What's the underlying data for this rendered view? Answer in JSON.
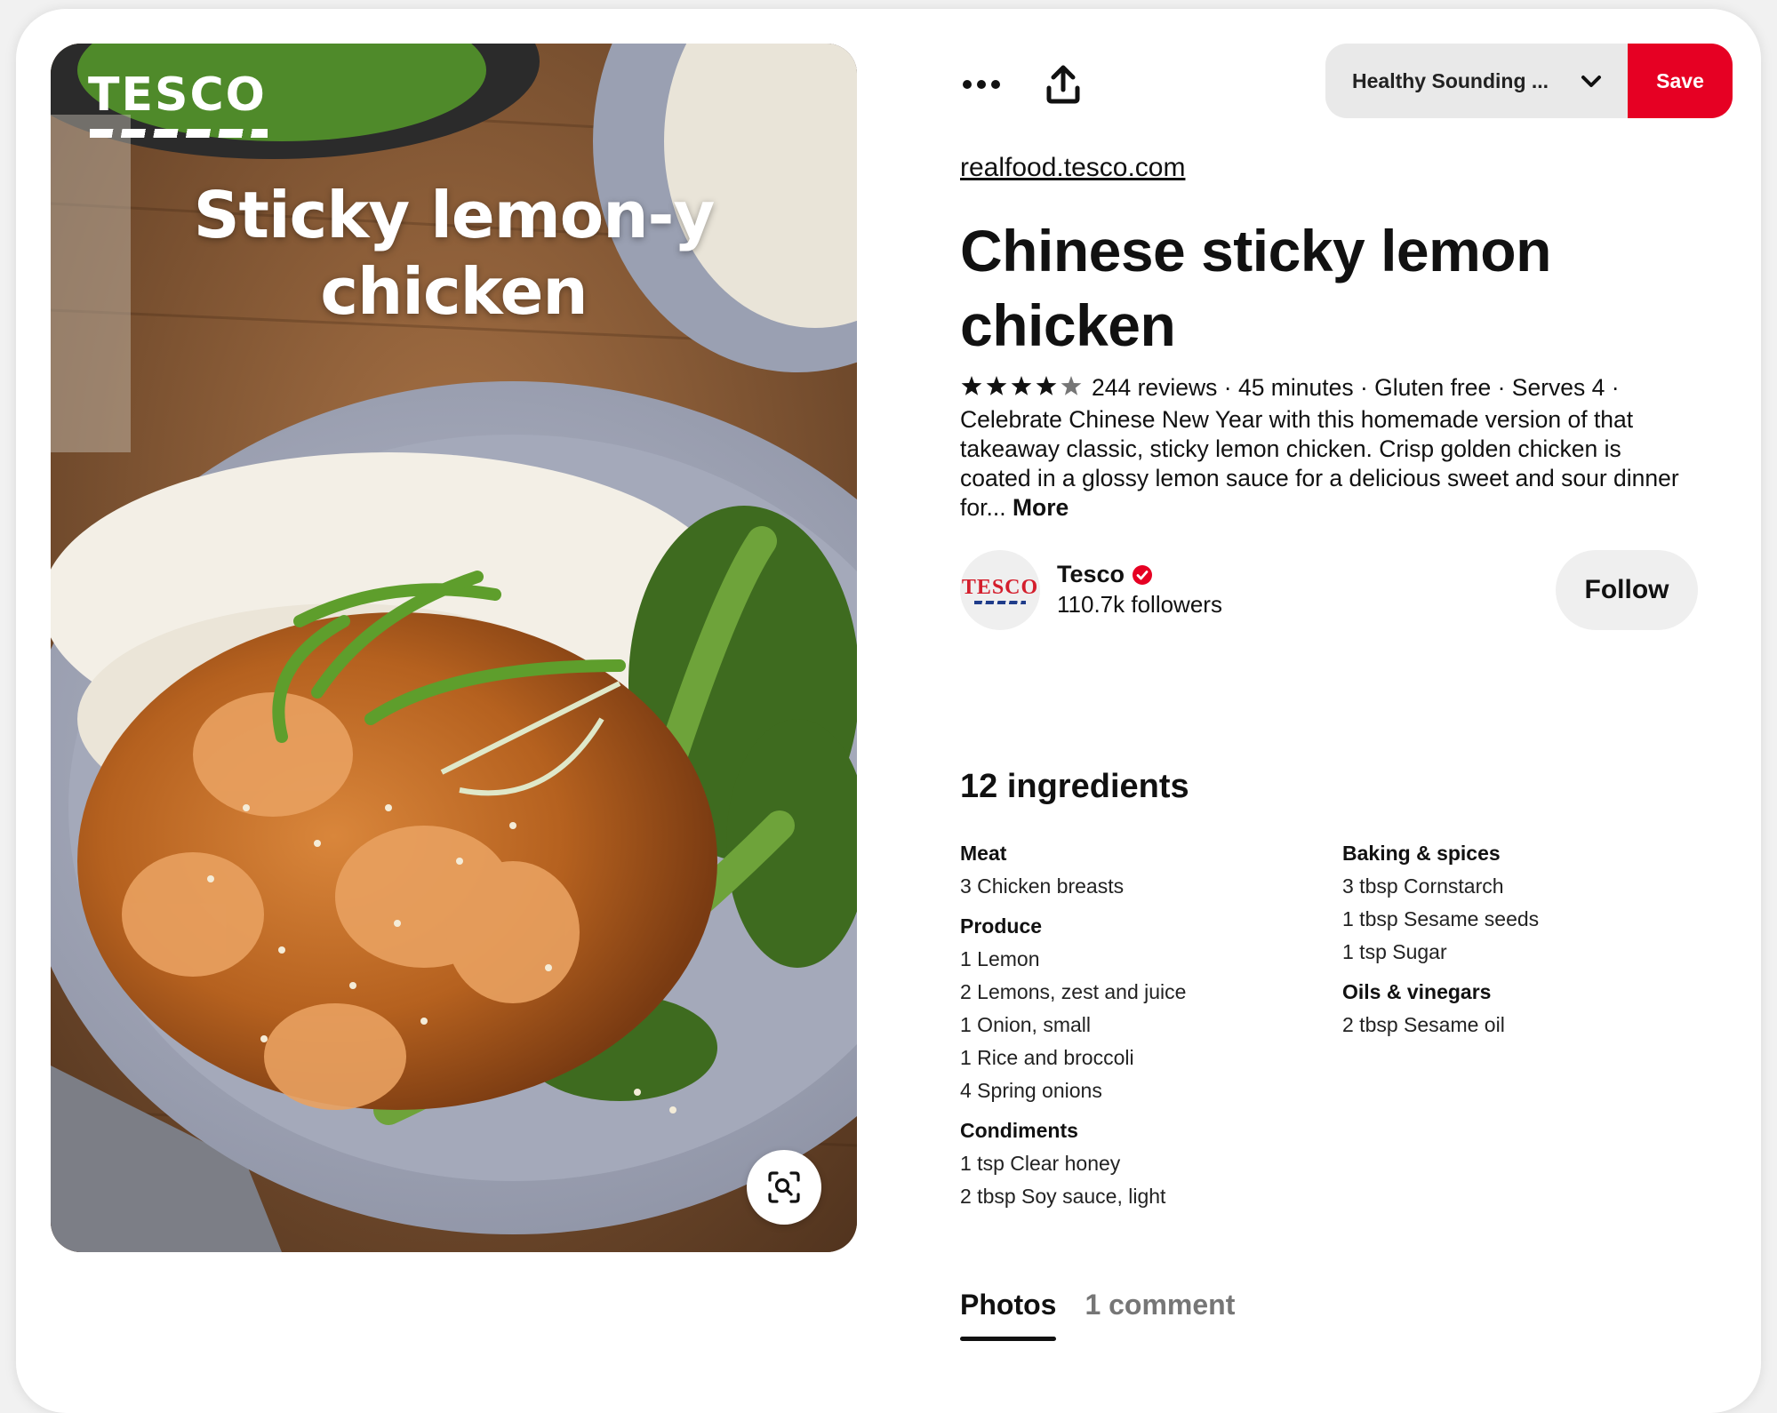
{
  "image": {
    "logo_text": "TESCO",
    "title_line1": "Sticky lemon-y",
    "title_line2": "chicken",
    "lens_icon": "visual-search-icon"
  },
  "toolbar": {
    "more_icon": "ellipsis-icon",
    "share_icon": "share-icon",
    "board_name": "Healthy Sounding ...",
    "board_chevron": "chevron-down-icon",
    "save_label": "Save",
    "save_color": "#e60023"
  },
  "pin": {
    "source_link": "realfood.tesco.com",
    "title": "Chinese sticky lemon chicken",
    "rating": 4,
    "rating_max": 5,
    "reviews": "244 reviews · 45 minutes · Gluten free · Serves 4 ·",
    "description": "Celebrate Chinese New Year with this homemade version of that takeaway classic, sticky lemon chicken. Crisp golden chicken is coated in a glossy lemon sauce for a delicious sweet and sour dinner for...",
    "more_label": "More"
  },
  "creator": {
    "avatar_text": "TESCO",
    "name": "Tesco",
    "verified_icon": "verified-badge-icon",
    "verified_color": "#e60023",
    "followers": "110.7k followers",
    "follow_label": "Follow"
  },
  "ingredients": {
    "heading": "12 ingredients",
    "left": [
      {
        "category": "Meat",
        "items": [
          "3 Chicken breasts"
        ]
      },
      {
        "category": "Produce",
        "items": [
          "1 Lemon",
          "2 Lemons, zest and juice",
          "1 Onion, small",
          "1 Rice and broccoli",
          "4 Spring onions"
        ]
      },
      {
        "category": "Condiments",
        "items": [
          "1 tsp Clear honey",
          "2 tbsp Soy sauce, light"
        ]
      }
    ],
    "right": [
      {
        "category": "Baking & spices",
        "items": [
          "3 tbsp Cornstarch",
          "1 tbsp Sesame seeds",
          "1 tsp Sugar"
        ]
      },
      {
        "category": "Oils & vinegars",
        "items": [
          "2 tbsp Sesame oil"
        ]
      }
    ]
  },
  "tabs": [
    {
      "label": "Photos",
      "active": true
    },
    {
      "label": "1 comment",
      "active": false
    }
  ]
}
